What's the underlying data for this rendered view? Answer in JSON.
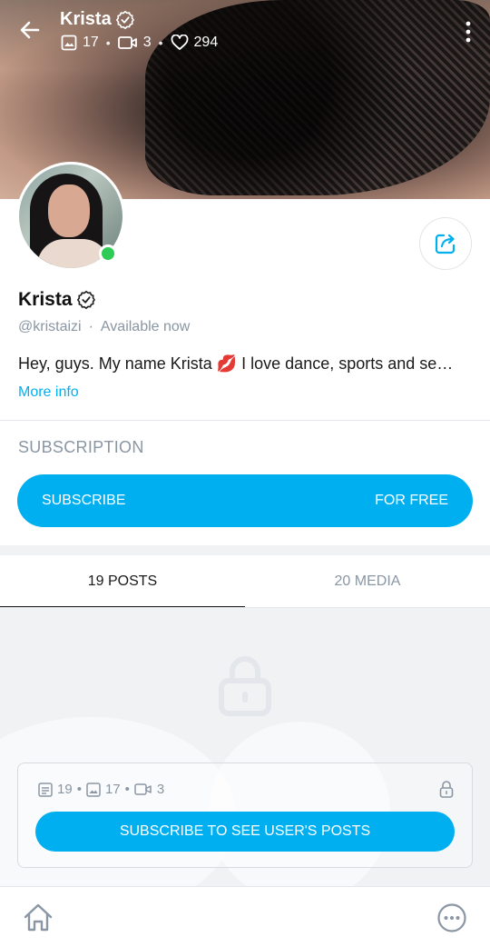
{
  "header": {
    "name": "Krista",
    "stats": {
      "photos": "17",
      "videos": "3",
      "likes": "294"
    },
    "dot": "•"
  },
  "profile": {
    "name": "Krista",
    "username": "@kristaizi",
    "separator": "·",
    "status": "Available now",
    "bio": "Hey, guys. My name Krista 💋 I love dance, sports and se…",
    "more_info": "More info",
    "online": true
  },
  "subscription": {
    "title": "SUBSCRIPTION",
    "button_left": "SUBSCRIBE",
    "button_right": "FOR FREE"
  },
  "tabs": [
    {
      "label": "19 POSTS",
      "active": true
    },
    {
      "label": "20 MEDIA",
      "active": false
    }
  ],
  "locked_card": {
    "posts": "19",
    "photos": "17",
    "videos": "3",
    "dot": "•",
    "button": "SUBSCRIBE TO SEE USER'S POSTS"
  },
  "colors": {
    "accent": "#00aff0",
    "online": "#2ecc57",
    "muted": "#8a96a3"
  },
  "icons": {
    "back": "arrow-left-icon",
    "verified": "verified-badge-icon",
    "photo": "image-icon",
    "video": "video-icon",
    "likes": "heart-icon",
    "menu": "kebab-menu-icon",
    "share": "share-icon",
    "lock": "lock-icon",
    "post": "post-icon",
    "home": "home-icon",
    "more": "more-icon"
  }
}
